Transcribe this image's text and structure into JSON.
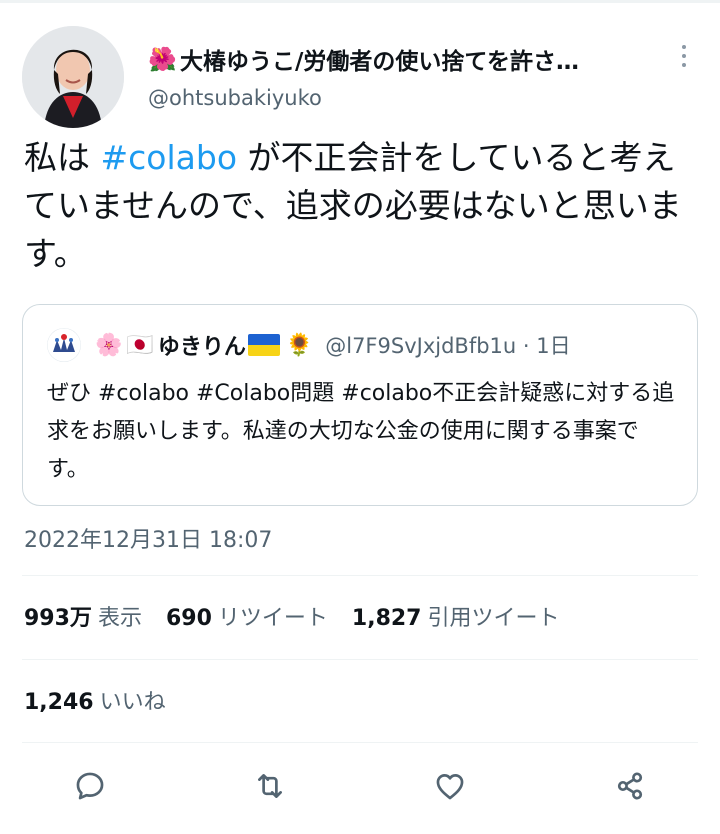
{
  "tweet": {
    "author": {
      "emoji": "🌺",
      "display_name": "大椿ゆうこ/労働者の使い捨てを許さ…",
      "handle": "@ohtsubakiyuko"
    },
    "text": {
      "part1": "私は ",
      "hashtag": "#colabo",
      "part2": " が不正会計をしていると考えていませんので、追求の必要はないと思います。"
    },
    "quote": {
      "emoji_flower": "🌸",
      "emoji_jp_flag": "🇯🇵",
      "name": "ゆきりん",
      "emoji_sunflower": "🌻",
      "handle": "@l7F9SvJxjdBfb1u · 1日",
      "text": "ぜひ #colabo #Colabo問題 #colabo不正会計疑惑に対する追求をお願いします。私達の大切な公金の使用に関する事案です。"
    },
    "timestamp": "2022年12月31日 18:07",
    "stats": {
      "views_count": "993万",
      "views_label": "表示",
      "retweets_count": "690",
      "retweets_label": "リツイート",
      "quotes_count": "1,827",
      "quotes_label": "引用ツイート",
      "likes_count": "1,246",
      "likes_label": "いいね"
    },
    "actions": [
      "reply-icon",
      "retweet-icon",
      "like-icon",
      "share-icon"
    ],
    "colors": {
      "hashtag": "#1d9bf0",
      "secondary_text": "#536471",
      "border": "#cfd9de",
      "divider": "#eff3f4"
    }
  }
}
